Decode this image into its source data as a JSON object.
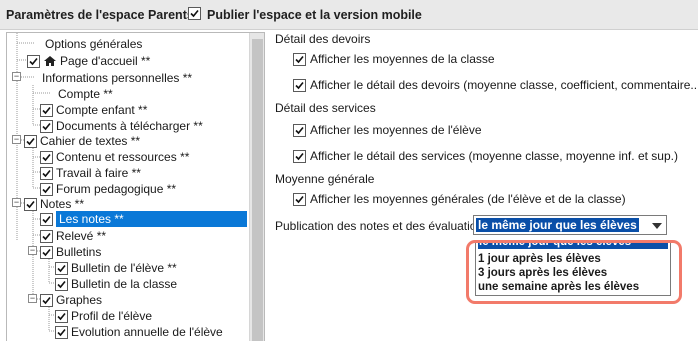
{
  "header": {
    "title": "Paramètres de l'espace Parents",
    "publish_label": "Publier l'espace et la version mobile"
  },
  "tree": {
    "items": [
      {
        "label": "Options générales",
        "checked": false
      },
      {
        "label": "Page d'accueil **",
        "checked": true
      },
      {
        "label": "Informations personnelles **",
        "checked": false
      },
      {
        "label": "Compte **",
        "checked": false
      },
      {
        "label": "Compte enfant **",
        "checked": true
      },
      {
        "label": "Documents à télécharger **",
        "checked": true
      },
      {
        "label": "Cahier de textes **",
        "checked": true
      },
      {
        "label": "Contenu et ressources **",
        "checked": true
      },
      {
        "label": "Travail à faire **",
        "checked": true
      },
      {
        "label": "Forum pedagogique **",
        "checked": true
      },
      {
        "label": "Notes **",
        "checked": true
      },
      {
        "label": "Les notes **",
        "checked": true
      },
      {
        "label": "Relevé **",
        "checked": true
      },
      {
        "label": "Bulletins",
        "checked": true
      },
      {
        "label": "Bulletin de l'élève **",
        "checked": true
      },
      {
        "label": "Bulletin de la classe",
        "checked": true
      },
      {
        "label": "Graphes",
        "checked": true
      },
      {
        "label": "Profil de l'élève",
        "checked": true
      },
      {
        "label": "Evolution annuelle de l'élève",
        "checked": true
      }
    ]
  },
  "devoirs": {
    "title": "Détail des devoirs",
    "opt1": "Afficher les moyennes de la classe",
    "opt2": "Afficher le détail des devoirs (moyenne classe, coefficient, commentaire...)"
  },
  "services": {
    "title": "Détail des services",
    "opt1": "Afficher les moyennes de l'élève",
    "opt2": "Afficher le détail des services (moyenne classe, moyenne inf. et sup.)"
  },
  "generale": {
    "title": "Moyenne générale",
    "opt1": "Afficher les moyennes générales (de l'élève et de la classe)"
  },
  "publication": {
    "label": "Publication des notes et des évaluations",
    "selected": "le même jour que les élèves",
    "options": [
      "le même jour que les élèves",
      "1 jour après les élèves",
      "3 jours après les élèves",
      "une semaine après les élèves"
    ]
  },
  "colors": {
    "accent": "#0a78d7",
    "highlight": "#0a4fa8",
    "callout": "#f27a6a"
  }
}
